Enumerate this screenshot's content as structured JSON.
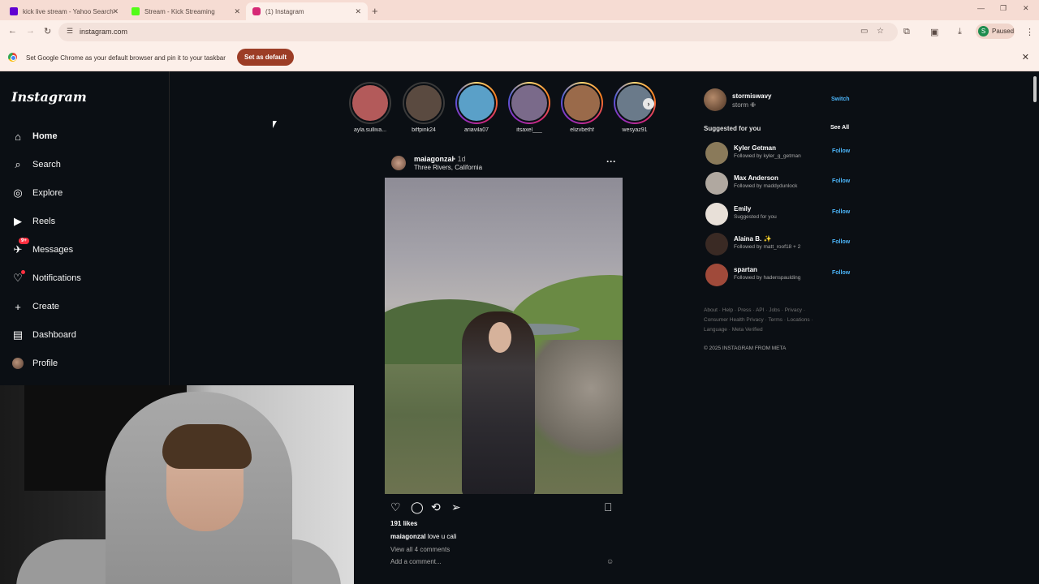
{
  "browser": {
    "tabs": [
      {
        "label": "kick live stream - Yahoo Search",
        "favicon_color": "#6001d2"
      },
      {
        "label": "Stream - Kick Streaming",
        "favicon_color": "#53fc18"
      },
      {
        "label": "(1) Instagram",
        "favicon_color": "#d62976"
      }
    ],
    "new_tab_icon": "plus-icon",
    "url": "instagram.com",
    "profile_initial": "S",
    "profile_status": "Paused",
    "infobar_message": "Set Google Chrome as your default browser and pin it to your taskbar",
    "infobar_button": "Set as default"
  },
  "sidebar": {
    "logo": "Instagram",
    "items": [
      {
        "label": "Home",
        "icon": "home-icon",
        "glyph": "⌂"
      },
      {
        "label": "Search",
        "icon": "search-icon",
        "glyph": "⌕"
      },
      {
        "label": "Explore",
        "icon": "compass-icon",
        "glyph": "◎"
      },
      {
        "label": "Reels",
        "icon": "reels-icon",
        "glyph": "▶"
      },
      {
        "label": "Messages",
        "icon": "messenger-icon",
        "glyph": "✈",
        "badge": "9+"
      },
      {
        "label": "Notifications",
        "icon": "heart-icon",
        "glyph": "♡"
      },
      {
        "label": "Create",
        "icon": "plus-icon",
        "glyph": "+"
      },
      {
        "label": "Dashboard",
        "icon": "dashboard-icon",
        "glyph": "▤"
      },
      {
        "label": "Profile",
        "icon": "avatar"
      }
    ]
  },
  "stories": [
    {
      "name": "ayla.sulliva...",
      "seen": true,
      "color": "#b35a5a"
    },
    {
      "name": "biffpink24",
      "seen": true,
      "color": "#5a4a40"
    },
    {
      "name": "ariavila07",
      "seen": false,
      "color": "#5aa0c8"
    },
    {
      "name": "itsaxel___",
      "seen": false,
      "color": "#7a6a8a"
    },
    {
      "name": "elizvbethf",
      "seen": false,
      "color": "#9a6a4a"
    },
    {
      "name": "wesyaz91",
      "seen": false,
      "color": "#6a7a8a"
    }
  ],
  "post": {
    "username": "maiagonzal",
    "time": "• 1d",
    "location": "Three Rivers, California",
    "likes": "191 likes",
    "caption_user": "maiagonzal",
    "caption_text": "love u cali",
    "view_comments": "View all 4 comments",
    "add_comment": "Add a comment..."
  },
  "account": {
    "username": "stormiswavy",
    "name": "storm ✙",
    "switch": "Switch"
  },
  "suggestions_title": "Suggested for you",
  "see_all": "See All",
  "suggestions": [
    {
      "name": "Kyler Getman",
      "sub": "Followed by kyler_g_getman",
      "action": "Follow",
      "color": "#8a7a5a"
    },
    {
      "name": "Max Anderson",
      "sub": "Followed by maddydunlock",
      "action": "Follow",
      "color": "#b0a8a0"
    },
    {
      "name": "Emily",
      "sub": "Suggested for you",
      "action": "Follow",
      "color": "#e8e0d8"
    },
    {
      "name": "Alaina B. ✨",
      "sub": "Followed by matt_roof18 + 2",
      "action": "Follow",
      "color": "#3a2a24"
    },
    {
      "name": "spartan",
      "sub": "Followed by hadenspaulding",
      "action": "Follow",
      "color": "#a04a3a"
    }
  ],
  "footer": {
    "line1": "About · Help · Press · API · Jobs · Privacy ·",
    "line2": "Consumer Health Privacy · Terms · Locations ·",
    "line3": "Language · Meta Verified",
    "copyright": "© 2025 INSTAGRAM FROM META"
  }
}
